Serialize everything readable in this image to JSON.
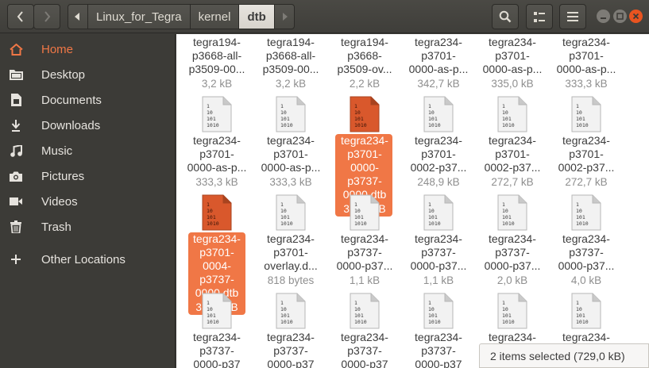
{
  "header": {
    "path": [
      "Linux_for_Tegra",
      "kernel",
      "dtb"
    ]
  },
  "sidebar": {
    "items": [
      {
        "label": "Home",
        "icon": "home-icon",
        "active": true
      },
      {
        "label": "Desktop",
        "icon": "desktop-folder-icon"
      },
      {
        "label": "Documents",
        "icon": "documents-icon"
      },
      {
        "label": "Downloads",
        "icon": "downloads-icon"
      },
      {
        "label": "Music",
        "icon": "music-icon"
      },
      {
        "label": "Pictures",
        "icon": "pictures-icon"
      },
      {
        "label": "Videos",
        "icon": "videos-icon"
      },
      {
        "label": "Trash",
        "icon": "trash-icon"
      },
      {
        "label": "Other Locations",
        "icon": "plus-icon"
      }
    ]
  },
  "files": {
    "row0": [
      {
        "name": "tegra194-\np3668-all-\np3509-00...",
        "size": "3,2 kB"
      },
      {
        "name": "tegra194-\np3668-all-\np3509-00...",
        "size": "3,2 kB"
      },
      {
        "name": "tegra194-\np3668-\np3509-ov...",
        "size": "2,2 kB"
      },
      {
        "name": "tegra234-\np3701-\n0000-as-p...",
        "size": "342,7 kB"
      },
      {
        "name": "tegra234-\np3701-\n0000-as-p...",
        "size": "335,0 kB"
      },
      {
        "name": "tegra234-\np3701-\n0000-as-p...",
        "size": "333,3 kB"
      }
    ],
    "row1": [
      {
        "name": "tegra234-\np3701-\n0000-as-p...",
        "size": "333,3 kB"
      },
      {
        "name": "tegra234-\np3701-\n0000-as-p...",
        "size": "333,3 kB"
      },
      {
        "name": "tegra234-\np3701-\n0000-\np3737-\n0000.dtb",
        "size": "364,5 kB",
        "selected": true
      },
      {
        "name": "tegra234-\np3701-\n0002-p37...",
        "size": "248,9 kB"
      },
      {
        "name": "tegra234-\np3701-\n0002-p37...",
        "size": "272,7 kB"
      },
      {
        "name": "tegra234-\np3701-\n0002-p37...",
        "size": "272,7 kB"
      }
    ],
    "row2": [
      {
        "name": "tegra234-\np3701-\n0004-\np3737-\n0000.dtb",
        "size": "364,5 kB",
        "selected": true
      },
      {
        "name": "tegra234-\np3701-\noverlay.d...",
        "size": "818 bytes"
      },
      {
        "name": "tegra234-\np3737-\n0000-p37...",
        "size": "1,1 kB"
      },
      {
        "name": "tegra234-\np3737-\n0000-p37...",
        "size": "1,1 kB"
      },
      {
        "name": "tegra234-\np3737-\n0000-p37...",
        "size": "2,0 kB"
      },
      {
        "name": "tegra234-\np3737-\n0000-p37...",
        "size": "4,0 kB"
      }
    ],
    "row3": [
      {
        "name": "tegra234-\np3737-\n0000-p37",
        "size": ""
      },
      {
        "name": "tegra234-\np3737-\n0000-p37",
        "size": ""
      },
      {
        "name": "tegra234-\np3737-\n0000-p37",
        "size": ""
      },
      {
        "name": "tegra234-\np3737-\n0000-p37",
        "size": ""
      },
      {
        "name": "tegra234-\np3737-\n0000-p37",
        "size": ""
      },
      {
        "name": "tegra234-\np3737-\n0000-p37",
        "size": ""
      }
    ],
    "doc_glyph": "1\n10\n101\n1010"
  },
  "status": {
    "text": "2 items selected  (729,0 kB)"
  },
  "colors": {
    "accent": "#f07746",
    "selected_doc": "#d9582c",
    "sidebar_bg": "#3c3b37",
    "close_button": "#e95420"
  }
}
